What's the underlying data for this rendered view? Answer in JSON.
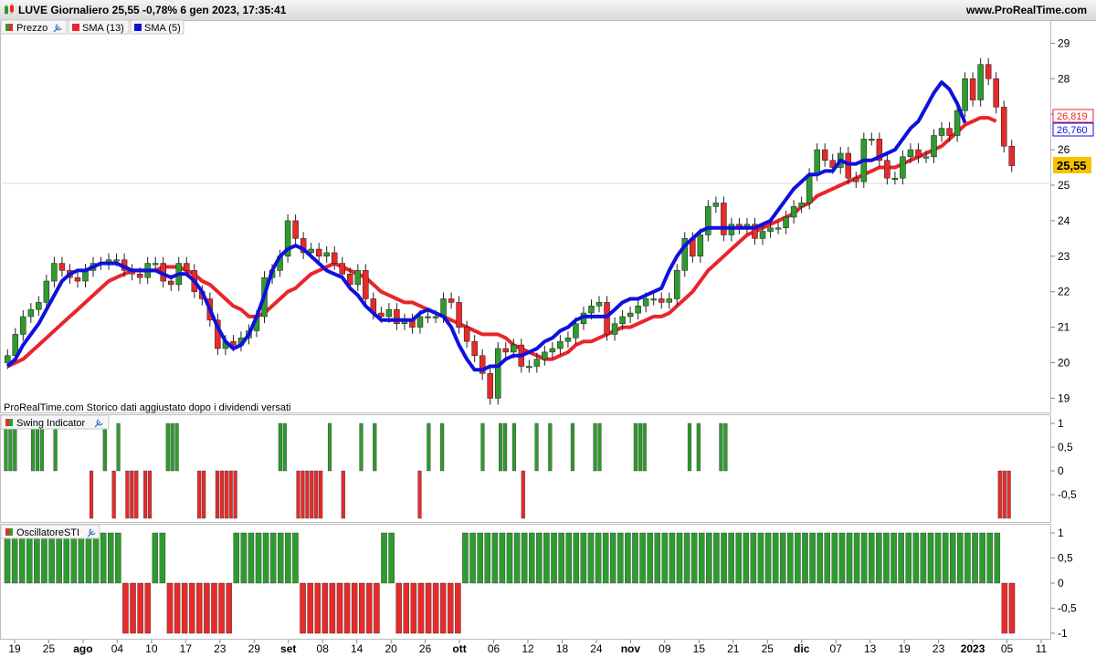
{
  "header": {
    "title": "LUVE Giornaliero 25,55 -0,78% 6 gen 2023, 17:35:41",
    "site": "www.ProRealTime.com"
  },
  "colors": {
    "up": "#2e9b2e",
    "down": "#e82a2a",
    "sma13": "#e8262a",
    "sma5": "#1010dd",
    "tag_last": "#f5c400"
  },
  "price_panel": {
    "legend": [
      {
        "label": "Prezzo",
        "color": "#2e9b2e"
      },
      {
        "label": "SMA (13)",
        "color": "#e8262a"
      },
      {
        "label": "SMA (5)",
        "color": "#1010dd"
      }
    ],
    "note": "ProRealTime.com Storico dati aggiustato dopo i dividendi versati",
    "tags": {
      "sma13": "26,819",
      "sma5": "26,760",
      "last": "25,55"
    }
  },
  "swing_panel": {
    "label": "Swing Indicator"
  },
  "sti_panel": {
    "label": "OscillatoreSTI"
  },
  "chart_data": [
    {
      "type": "candlestick",
      "title": "",
      "ylim": [
        18.6,
        29.6
      ],
      "yticks": [
        "19",
        "20",
        "21",
        "22",
        "23",
        "24",
        "25",
        "26",
        "27",
        "28",
        "29"
      ],
      "xtick_labels": [
        "19",
        "25",
        "ago",
        "04",
        "10",
        "17",
        "23",
        "29",
        "set",
        "08",
        "14",
        "20",
        "26",
        "ott",
        "06",
        "12",
        "18",
        "24",
        "nov",
        "09",
        "15",
        "21",
        "25",
        "dic",
        "07",
        "13",
        "19",
        "23",
        "2023",
        "05",
        "11"
      ],
      "close": [
        20.2,
        20.8,
        21.3,
        21.5,
        21.7,
        22.3,
        22.8,
        22.6,
        22.4,
        22.3,
        22.6,
        22.8,
        22.8,
        22.9,
        22.9,
        22.6,
        22.5,
        22.4,
        22.8,
        22.8,
        22.3,
        22.2,
        22.8,
        22.6,
        22.0,
        21.8,
        21.2,
        20.4,
        20.6,
        20.5,
        20.7,
        20.9,
        21.3,
        22.4,
        22.6,
        23.0,
        24.0,
        23.5,
        23.1,
        23.2,
        23.0,
        23.1,
        22.8,
        22.5,
        22.2,
        22.6,
        21.8,
        21.4,
        21.3,
        21.5,
        21.1,
        21.2,
        21.0,
        21.3,
        21.3,
        21.3,
        21.8,
        21.7,
        21.0,
        20.6,
        20.2,
        19.7,
        19.0,
        20.4,
        20.3,
        20.5,
        19.9,
        19.9,
        20.1,
        20.3,
        20.4,
        20.6,
        20.7,
        21.1,
        21.4,
        21.6,
        21.7,
        20.8,
        21.1,
        21.3,
        21.4,
        21.6,
        21.8,
        21.8,
        21.7,
        21.8,
        22.6,
        23.5,
        23.0,
        23.6,
        24.4,
        24.5,
        23.6,
        23.9,
        23.8,
        23.9,
        23.5,
        23.7,
        23.8,
        23.8,
        24.1,
        24.4,
        24.5,
        25.3,
        26.0,
        25.7,
        25.5,
        25.9,
        25.2,
        25.1,
        26.3,
        26.3,
        25.7,
        25.2,
        25.2,
        25.8,
        26.0,
        25.8,
        25.8,
        26.4,
        26.6,
        26.4,
        27.1,
        28.0,
        27.4,
        28.4,
        28.0,
        27.2,
        26.1,
        25.55
      ],
      "sma13": [
        19.9,
        20.0,
        20.1,
        20.3,
        20.5,
        20.7,
        20.9,
        21.1,
        21.3,
        21.5,
        21.7,
        21.9,
        22.1,
        22.3,
        22.4,
        22.5,
        22.6,
        22.6,
        22.6,
        22.6,
        22.7,
        22.7,
        22.7,
        22.6,
        22.5,
        22.3,
        22.2,
        22.0,
        21.8,
        21.6,
        21.5,
        21.3,
        21.3,
        21.4,
        21.6,
        21.8,
        22.0,
        22.1,
        22.3,
        22.5,
        22.6,
        22.7,
        22.8,
        22.7,
        22.6,
        22.5,
        22.4,
        22.2,
        22.0,
        21.9,
        21.8,
        21.7,
        21.7,
        21.6,
        21.5,
        21.4,
        21.3,
        21.2,
        21.1,
        21.0,
        20.9,
        20.8,
        20.8,
        20.8,
        20.7,
        20.5,
        20.4,
        20.3,
        20.2,
        20.1,
        20.1,
        20.2,
        20.3,
        20.5,
        20.6,
        20.6,
        20.7,
        20.8,
        20.9,
        21.0,
        21.0,
        21.1,
        21.2,
        21.3,
        21.3,
        21.4,
        21.6,
        21.8,
        22.0,
        22.3,
        22.6,
        22.8,
        23.0,
        23.2,
        23.4,
        23.6,
        23.7,
        23.8,
        23.9,
        24.0,
        24.1,
        24.2,
        24.4,
        24.5,
        24.7,
        24.8,
        24.9,
        25.0,
        25.1,
        25.2,
        25.3,
        25.4,
        25.5,
        25.5,
        25.5,
        25.6,
        25.7,
        25.8,
        25.9,
        26.0,
        26.1,
        26.3,
        26.5,
        26.7,
        26.8,
        26.9,
        26.9,
        26.8
      ],
      "sma5": [
        19.9,
        20.1,
        20.5,
        20.8,
        21.1,
        21.5,
        21.9,
        22.3,
        22.5,
        22.6,
        22.6,
        22.7,
        22.8,
        22.8,
        22.8,
        22.7,
        22.6,
        22.6,
        22.6,
        22.6,
        22.5,
        22.4,
        22.5,
        22.5,
        22.3,
        22.0,
        21.5,
        21.0,
        20.6,
        20.4,
        20.5,
        20.8,
        21.3,
        21.9,
        22.6,
        23.0,
        23.2,
        23.3,
        23.2,
        23.0,
        22.8,
        22.6,
        22.5,
        22.4,
        22.1,
        21.9,
        21.6,
        21.4,
        21.2,
        21.2,
        21.2,
        21.2,
        21.2,
        21.4,
        21.5,
        21.4,
        21.3,
        21.0,
        20.5,
        20.1,
        19.8,
        19.8,
        19.9,
        19.9,
        20.1,
        20.2,
        20.2,
        20.3,
        20.4,
        20.6,
        20.7,
        20.9,
        21.0,
        21.2,
        21.3,
        21.3,
        21.3,
        21.3,
        21.5,
        21.7,
        21.8,
        21.8,
        21.9,
        22.0,
        22.1,
        22.6,
        23.0,
        23.3,
        23.5,
        23.7,
        23.8,
        23.8,
        23.8,
        23.8,
        23.8,
        23.8,
        23.8,
        23.9,
        24.0,
        24.3,
        24.6,
        24.9,
        25.1,
        25.3,
        25.3,
        25.4,
        25.4,
        25.7,
        25.6,
        25.6,
        25.7,
        25.7,
        25.8,
        25.9,
        26.0,
        26.3,
        26.6,
        26.8,
        27.2,
        27.6,
        27.9,
        27.7,
        27.3,
        26.76
      ]
    },
    {
      "type": "bar",
      "title": "Swing Indicator",
      "ylim": [
        -1,
        1
      ],
      "yticks": [
        "1",
        "0,5",
        "0",
        "-0,5"
      ],
      "values": [
        1,
        1,
        1,
        0,
        0,
        0,
        1,
        1,
        1,
        0,
        0,
        1,
        0,
        0,
        0,
        0,
        0,
        0,
        0,
        -1,
        0,
        0,
        1,
        0,
        -1,
        1,
        0,
        -1,
        -1,
        -1,
        0,
        -1,
        -1,
        0,
        0,
        0,
        1,
        1,
        1,
        0,
        0,
        0,
        0,
        -1,
        -1,
        0,
        0,
        -1,
        -1,
        -1,
        -1,
        -1,
        0,
        0,
        0,
        0,
        0,
        0,
        0,
        0,
        0,
        1,
        1,
        0,
        0,
        -1,
        -1,
        -1,
        -1,
        -1,
        -1,
        0,
        1,
        0,
        0,
        -1,
        0,
        0,
        0,
        1,
        0,
        0,
        1,
        0,
        0,
        0,
        0,
        0,
        0,
        0,
        0,
        0,
        -1,
        0,
        1,
        0,
        0,
        1,
        0,
        0,
        0,
        0,
        0,
        0,
        0,
        0,
        1,
        0,
        0,
        0,
        1,
        1,
        0,
        1,
        0,
        -1,
        0,
        0,
        1,
        0,
        0,
        1,
        0,
        0,
        0,
        0,
        1,
        0,
        0,
        0,
        0,
        1,
        1,
        0,
        0,
        0,
        0,
        0,
        0,
        0,
        1,
        1,
        1,
        0,
        0,
        0,
        0,
        0,
        0,
        0,
        0,
        0,
        1,
        0,
        1,
        0,
        0,
        0,
        0,
        1,
        1,
        0,
        0,
        0,
        0,
        0,
        0,
        0,
        0,
        0,
        0,
        0,
        0,
        0,
        0,
        0,
        0,
        0,
        0,
        0,
        0,
        0,
        0,
        0,
        0,
        0,
        0,
        0,
        0,
        0,
        0,
        0,
        0,
        0,
        0,
        0,
        0,
        0,
        0,
        0,
        0,
        0,
        0,
        0,
        0,
        0,
        0,
        0,
        0,
        0,
        0,
        0,
        0,
        0,
        0,
        0,
        0,
        0,
        0,
        0,
        0,
        -1,
        -1,
        -1,
        0
      ]
    },
    {
      "type": "bar",
      "title": "OscillatoreSTI",
      "ylim": [
        -1,
        1
      ],
      "yticks": [
        "1",
        "0,5",
        "0",
        "-0,5",
        "-1"
      ],
      "values": [
        1,
        1,
        1,
        1,
        1,
        1,
        1,
        1,
        1,
        1,
        1,
        1,
        1,
        1,
        1,
        1,
        -1,
        -1,
        -1,
        -1,
        1,
        1,
        -1,
        -1,
        -1,
        -1,
        -1,
        -1,
        -1,
        -1,
        -1,
        1,
        1,
        1,
        1,
        1,
        1,
        1,
        1,
        1,
        -1,
        -1,
        -1,
        -1,
        -1,
        -1,
        -1,
        -1,
        -1,
        -1,
        -1,
        1,
        1,
        -1,
        -1,
        -1,
        -1,
        -1,
        -1,
        -1,
        -1,
        -1,
        1,
        1,
        1,
        1,
        1,
        1,
        1,
        1,
        1,
        1,
        1,
        1,
        1,
        1,
        1,
        1,
        1,
        1,
        1,
        1,
        1,
        1,
        1,
        1,
        1,
        1,
        1,
        1,
        1,
        1,
        1,
        1,
        1,
        1,
        1,
        1,
        1,
        1,
        1,
        1,
        1,
        1,
        1,
        1,
        1,
        1,
        1,
        1,
        1,
        1,
        1,
        1,
        1,
        1,
        1,
        1,
        1,
        1,
        1,
        1,
        1,
        1,
        1,
        1,
        1,
        1,
        1,
        1,
        1,
        1,
        1,
        1,
        1,
        -1,
        -1
      ]
    }
  ]
}
